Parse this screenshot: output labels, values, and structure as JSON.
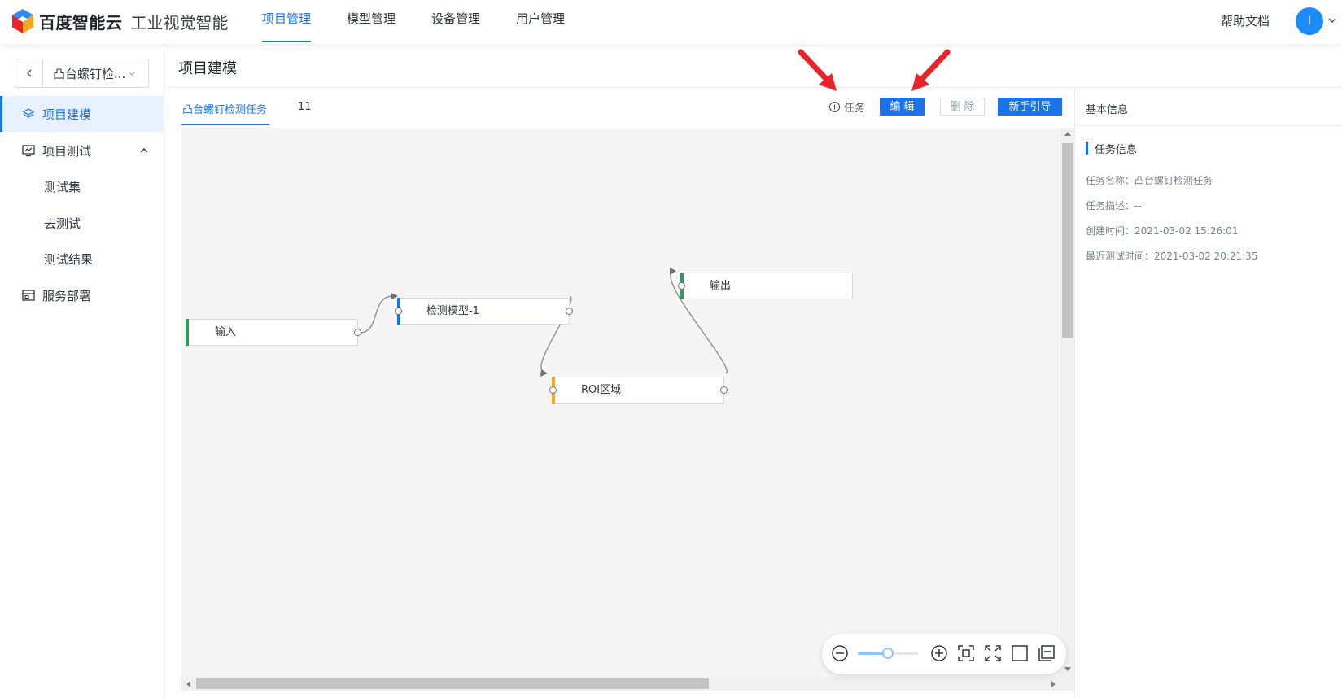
{
  "header": {
    "brand": "百度智能云",
    "product": "工业视觉智能",
    "nav": [
      "项目管理",
      "模型管理",
      "设备管理",
      "用户管理"
    ],
    "help": "帮助文档",
    "avatar_initial": "I"
  },
  "sidebar": {
    "project_name": "凸台螺钉检...",
    "items": [
      {
        "label": "项目建模"
      },
      {
        "label": "项目测试"
      },
      {
        "label": "测试集"
      },
      {
        "label": "去测试"
      },
      {
        "label": "测试结果"
      },
      {
        "label": "服务部署"
      }
    ]
  },
  "main": {
    "title": "项目建模",
    "tab_label": "凸台螺钉检测任务",
    "tab_count": "11",
    "toolbar": {
      "add_task": "任务",
      "edit": "编 辑",
      "delete": "删 除",
      "guide": "新手引导"
    },
    "nodes": [
      {
        "label": "输入"
      },
      {
        "label": "检测模型-1"
      },
      {
        "label": "ROI区域"
      },
      {
        "label": "输出"
      }
    ]
  },
  "panel": {
    "tab": "基本信息",
    "section": "任务信息",
    "rows": [
      "任务名称：凸台螺钉检测任务",
      "任务描述：--",
      "创建时间：2021-03-02 15:26:01",
      "最近测试时间：2021-03-02 20:21:35"
    ]
  },
  "colors": {
    "accent": "#1a73e8",
    "node_input": "#2e9d5a",
    "node_model": "#1a73e8",
    "node_roi": "#f5a623",
    "node_output": "#2e9d5a",
    "annotation": "#e8232a"
  }
}
